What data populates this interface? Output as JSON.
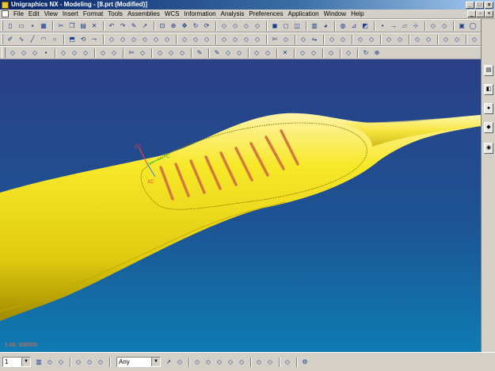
{
  "window": {
    "title": "Unigraphics NX - Modeling - [8.prt (Modified)]",
    "controls": [
      "minimize-icon",
      "maximize-icon",
      "close-icon"
    ]
  },
  "menu": {
    "items": [
      "File",
      "Edit",
      "View",
      "Insert",
      "Format",
      "Tools",
      "Assemblies",
      "WCS",
      "Information",
      "Analysis",
      "Preferences",
      "Application",
      "Window",
      "Help"
    ]
  },
  "toolbars": {
    "row1": [
      "new-icon",
      "open-icon",
      "save-icon",
      "print-icon",
      "|",
      "cut-icon",
      "copy-icon",
      "paste-icon",
      "delete-icon",
      "|",
      "undo-icon",
      "redo-icon",
      "edit-icon",
      "select-icon",
      "|",
      "fit-icon",
      "zoom-icon",
      "pan-icon",
      "rotate-icon",
      "refresh-icon",
      "|",
      "view-front-icon",
      "view-top-icon",
      "view-right-icon",
      "view-iso-icon",
      "|",
      "shaded-icon",
      "wireframe-icon",
      "hidden-icon",
      "|",
      "layer-icon",
      "color-icon",
      "|",
      "analysis-icon",
      "measure-icon",
      "section-icon",
      "|",
      "point-icon",
      "vector-icon",
      "plane-icon",
      "csys-icon",
      "|",
      "feature-icon",
      "datum-icon",
      "|",
      "block-icon",
      "cylinder-icon",
      "cone-icon",
      "sphere-icon",
      "|",
      "help-icon"
    ],
    "row2": [
      "sketch-icon",
      "curve-icon",
      "line-icon",
      "arc-icon",
      "circle-icon",
      "|",
      "extrude-icon",
      "revolve-icon",
      "sweep-icon",
      "|",
      "hole-icon",
      "boss-icon",
      "pocket-icon",
      "pad-icon",
      "slot-icon",
      "groove-icon",
      "|",
      "unite-icon",
      "subtract-icon",
      "intersect-icon",
      "|",
      "blend-icon",
      "chamfer-icon",
      "shell-icon",
      "taper-icon",
      "|",
      "trim-icon",
      "split-icon",
      "|",
      "pattern-icon",
      "mirror-icon",
      "|",
      "offset-icon",
      "scale-icon",
      "|",
      "sew-icon",
      "patch-icon",
      "|",
      "through-curves-icon",
      "mesh-icon",
      "|",
      "ruled-icon",
      "swept-icon",
      "|",
      "bridge-icon",
      "n-sided-icon",
      "|",
      "law-icon"
    ],
    "row3": [
      "snap-icon",
      "spline-icon",
      "polyline-icon",
      "point-set-icon",
      "|",
      "rectangle-icon",
      "polygon-icon",
      "ellipse-icon",
      "|",
      "fillet-icon",
      "chamfer-curve-icon",
      "|",
      "trim-curve-icon",
      "extend-icon",
      "|",
      "offset-curve-icon",
      "project-icon",
      "intersect-curve-icon",
      "|",
      "edit-curve-icon",
      "|",
      "edit-feature-icon",
      "suppress-icon",
      "unsuppress-icon",
      "|",
      "move-icon",
      "transform-icon",
      "|",
      "delete-feature-icon",
      "|",
      "surface-analysis-icon",
      "curvature-icon",
      "|",
      "draft-analysis-icon",
      "|",
      "free-form-icon",
      "|",
      "rotate-view-icon",
      "zoom-view-icon"
    ]
  },
  "rightStrip": [
    "navigator-icon",
    "history-icon",
    "palette-icon",
    "roles-icon",
    "assembly-nav-icon"
  ],
  "viewport": {
    "model": "yellow-handle-body",
    "csys_labels": {
      "zc": "ZC",
      "xc": "XC",
      "yc": "YC"
    },
    "statusCoord": "1.00, 000000",
    "colors": {
      "body": "#f2e21a",
      "slots": "#d97a3a",
      "bgTop": "#2b3f86",
      "bgBottom": "#0e7cb2"
    }
  },
  "bottombar": {
    "layerCombo": "1",
    "filterCombo": "Any",
    "tools": [
      "layer-settings-icon",
      "visible-in-view-icon",
      "move-to-layer-icon",
      "|",
      "show-hide-icon",
      "blank-icon",
      "unblank-icon",
      "|",
      "select-all-icon",
      "deselect-icon",
      "|",
      "snap-point-icon",
      "endpoint-icon",
      "midpoint-icon",
      "center-icon",
      "quadrant-icon",
      "|",
      "ortho-icon",
      "grid-icon",
      "|",
      "redisplay-icon",
      "|",
      "gear-icon"
    ]
  }
}
